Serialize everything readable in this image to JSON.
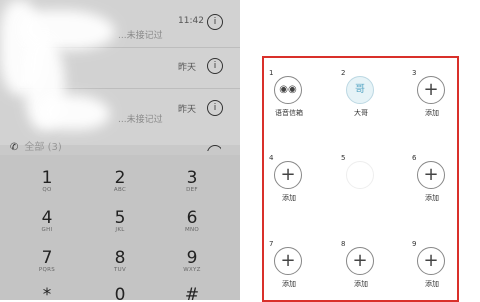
{
  "call_log": {
    "rows": [
      {
        "sub": "...未接记过",
        "time": "11:42",
        "info_icon": "i"
      },
      {
        "sub": "",
        "time": "昨天",
        "info_icon": "i"
      },
      {
        "sub": "...未接记过",
        "time": "昨天",
        "info_icon": "i"
      }
    ],
    "contacts_label": "全部 (3)"
  },
  "dialpad": {
    "keys": [
      {
        "digit": "1",
        "letters": "QO"
      },
      {
        "digit": "2",
        "letters": "ABC"
      },
      {
        "digit": "3",
        "letters": "DEF"
      },
      {
        "digit": "4",
        "letters": "GHI"
      },
      {
        "digit": "5",
        "letters": "JKL"
      },
      {
        "digit": "6",
        "letters": "MNO"
      },
      {
        "digit": "7",
        "letters": "PQRS"
      },
      {
        "digit": "8",
        "letters": "TUV"
      },
      {
        "digit": "9",
        "letters": "WXYZ"
      },
      {
        "digit": "*",
        "letters": ""
      },
      {
        "digit": "0",
        "letters": ""
      },
      {
        "digit": "#",
        "letters": ""
      }
    ]
  },
  "speed_dial": {
    "border_color": "#d9302a",
    "slots": [
      {
        "number": "1",
        "label": "语音信箱",
        "icon": "voicemail-icon"
      },
      {
        "number": "2",
        "label": "大哥",
        "avatar": "哥"
      },
      {
        "number": "3",
        "label": "添加",
        "icon": "plus-icon"
      },
      {
        "number": "4",
        "label": "添加",
        "icon": "plus-icon"
      },
      {
        "number": "5",
        "label": "",
        "icon": "blurred"
      },
      {
        "number": "6",
        "label": "添加",
        "icon": "plus-icon"
      },
      {
        "number": "7",
        "label": "添加",
        "icon": "plus-icon"
      },
      {
        "number": "8",
        "label": "添加",
        "icon": "plus-icon"
      },
      {
        "number": "9",
        "label": "添加",
        "icon": "plus-icon"
      }
    ]
  }
}
